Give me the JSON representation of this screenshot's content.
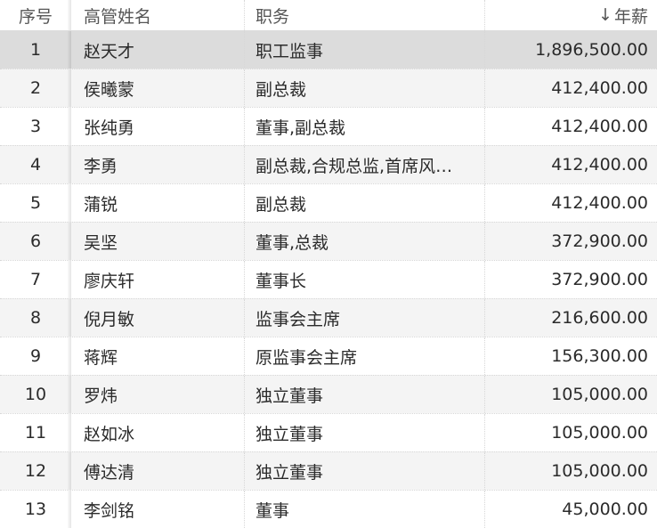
{
  "table": {
    "headers": {
      "index": "序号",
      "name": "高管姓名",
      "position": "职务",
      "salary": "年薪",
      "sort_indicator": "↓"
    },
    "rows": [
      {
        "index": "1",
        "name": "赵天才",
        "position": "职工监事",
        "salary": "1,896,500.00"
      },
      {
        "index": "2",
        "name": "侯曦蒙",
        "position": "副总裁",
        "salary": "412,400.00"
      },
      {
        "index": "3",
        "name": "张纯勇",
        "position": "董事,副总裁",
        "salary": "412,400.00"
      },
      {
        "index": "4",
        "name": "李勇",
        "position": "副总裁,合规总监,首席风…",
        "salary": "412,400.00"
      },
      {
        "index": "5",
        "name": "蒲锐",
        "position": "副总裁",
        "salary": "412,400.00"
      },
      {
        "index": "6",
        "name": "吴坚",
        "position": "董事,总裁",
        "salary": "372,900.00"
      },
      {
        "index": "7",
        "name": "廖庆轩",
        "position": "董事长",
        "salary": "372,900.00"
      },
      {
        "index": "8",
        "name": "倪月敏",
        "position": "监事会主席",
        "salary": "216,600.00"
      },
      {
        "index": "9",
        "name": "蒋辉",
        "position": "原监事会主席",
        "salary": "156,300.00"
      },
      {
        "index": "10",
        "name": "罗炜",
        "position": "独立董事",
        "salary": "105,000.00"
      },
      {
        "index": "11",
        "name": "赵如冰",
        "position": "独立董事",
        "salary": "105,000.00"
      },
      {
        "index": "12",
        "name": "傅达清",
        "position": "独立董事",
        "salary": "105,000.00"
      },
      {
        "index": "13",
        "name": "李剑铭",
        "position": "董事",
        "salary": "45,000.00"
      }
    ]
  },
  "colors": {
    "selected_row": "#dcdcdc",
    "alt_row": "#f4f4f4",
    "text": "#2b2b2b"
  }
}
